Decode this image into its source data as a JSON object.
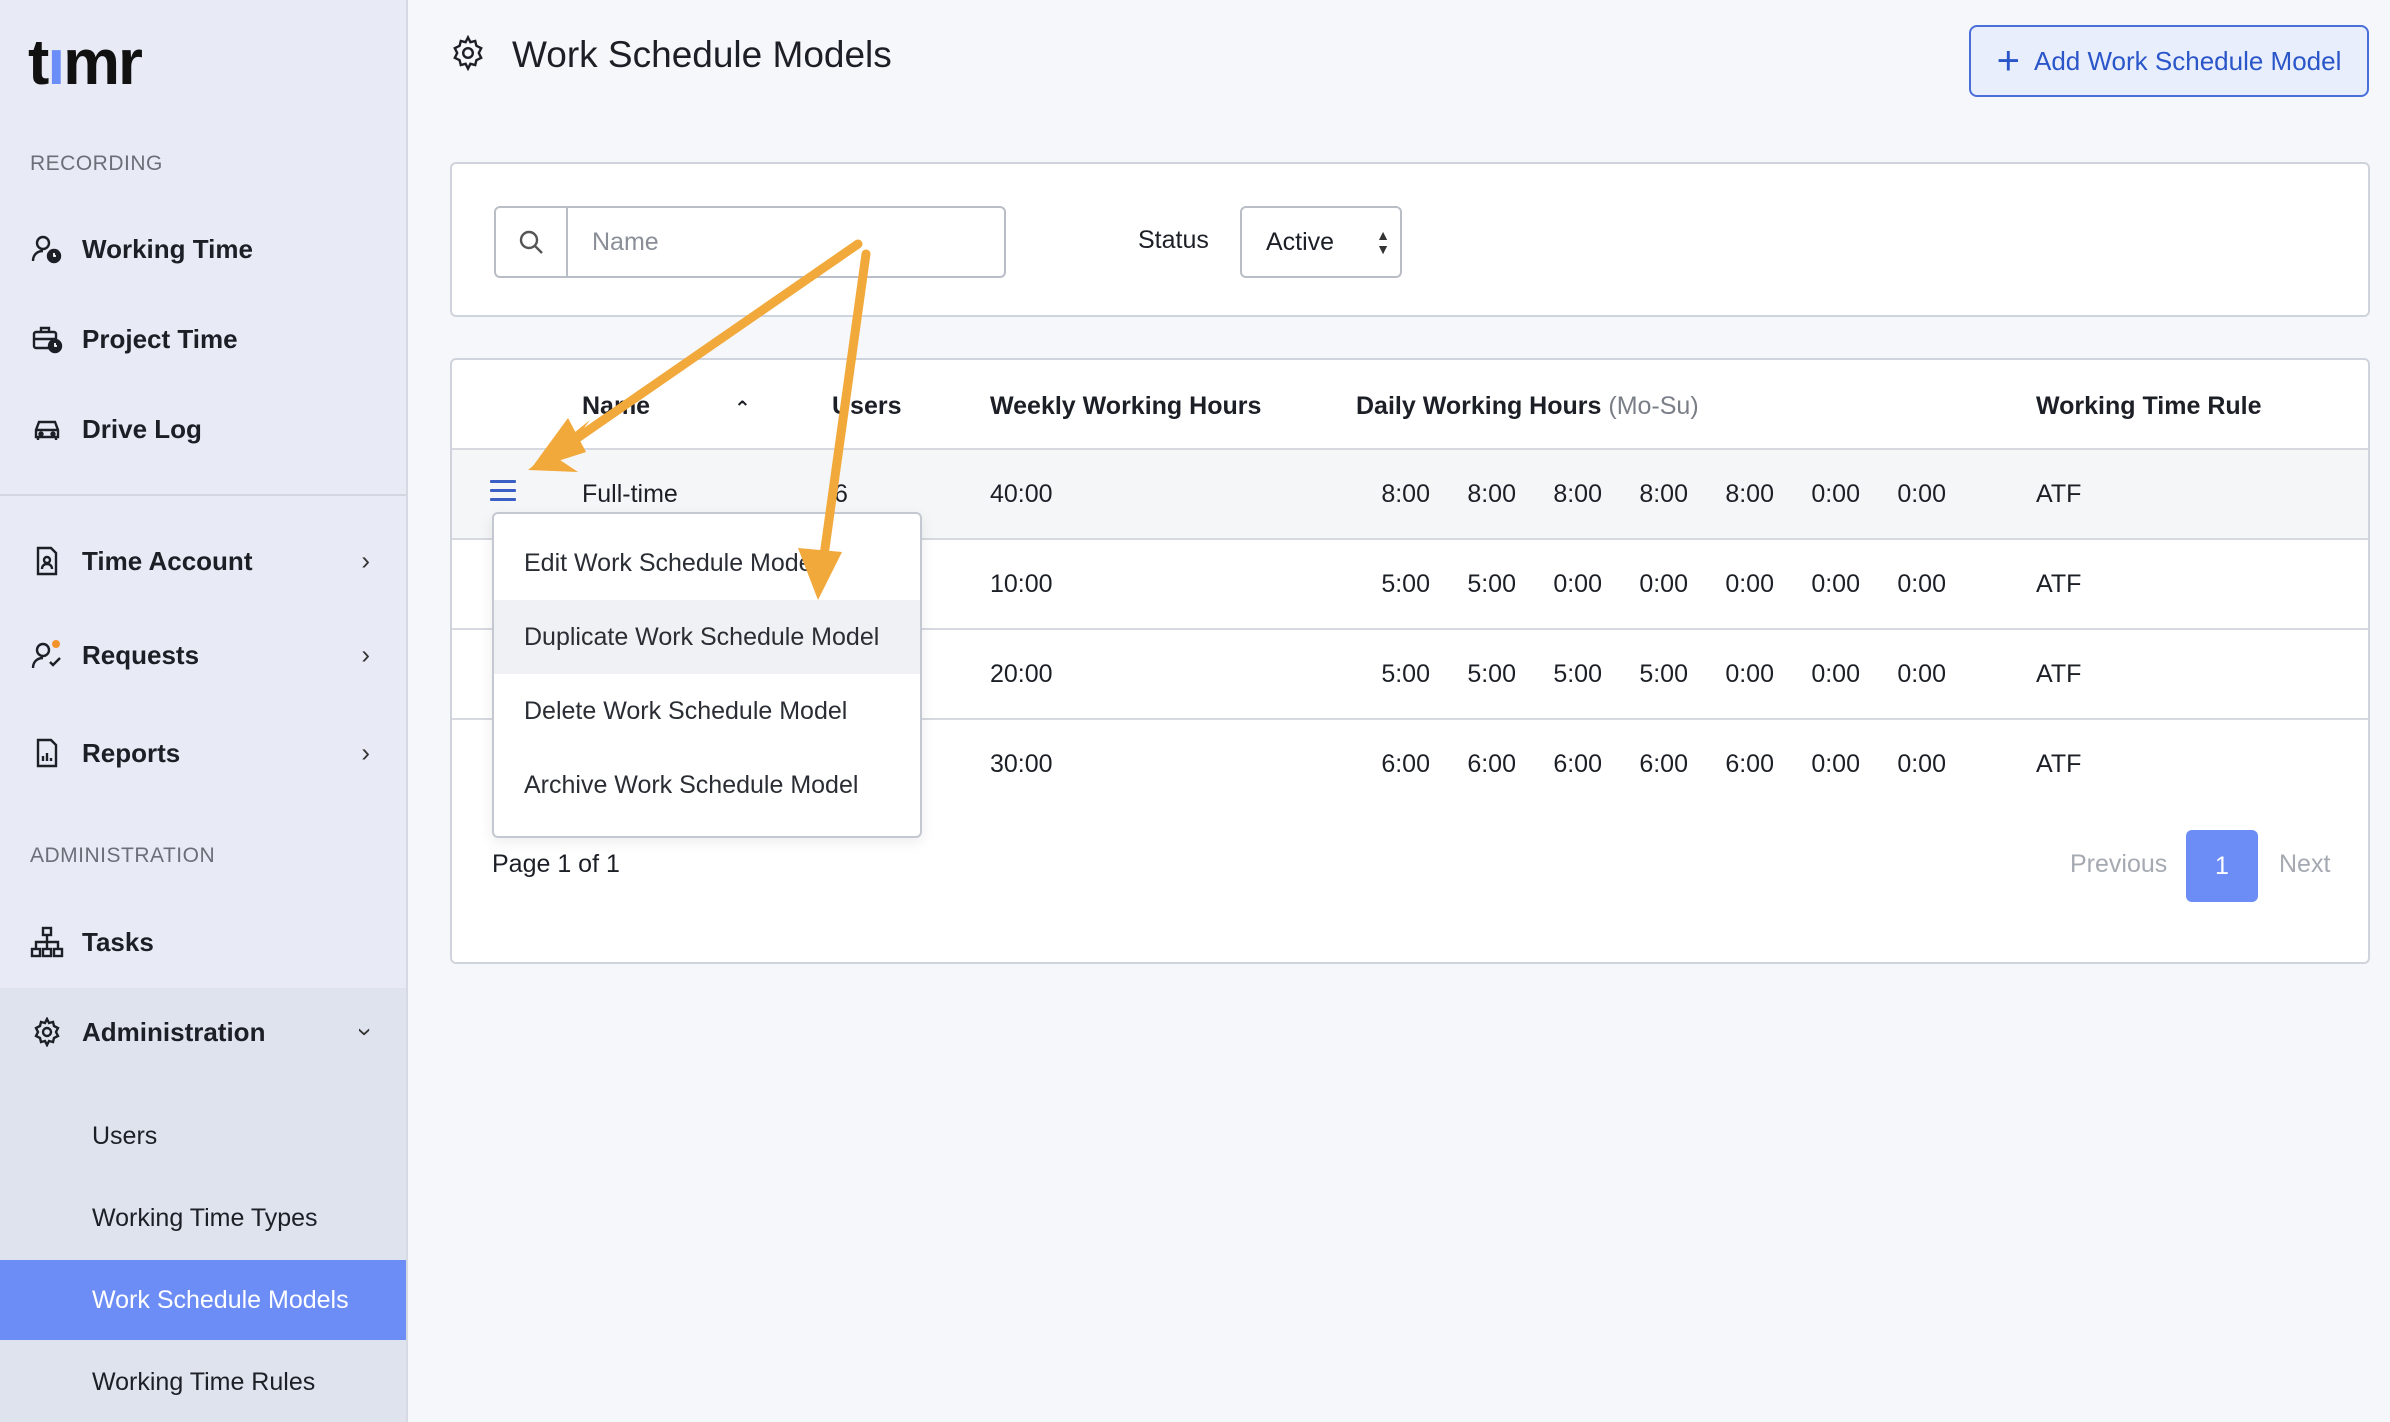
{
  "app": {
    "logo": "timr"
  },
  "sidebar": {
    "section_recording": "RECORDING",
    "section_administration": "ADMINISTRATION",
    "items": [
      {
        "label": "Working Time",
        "icon": "user-clock-icon"
      },
      {
        "label": "Project Time",
        "icon": "briefcase-clock-icon"
      },
      {
        "label": "Drive Log",
        "icon": "car-icon"
      },
      {
        "label": "Time Account",
        "icon": "file-user-icon"
      },
      {
        "label": "Requests",
        "icon": "user-check-icon"
      },
      {
        "label": "Reports",
        "icon": "report-icon"
      },
      {
        "label": "Tasks",
        "icon": "hierarchy-icon"
      },
      {
        "label": "Administration",
        "icon": "gear-icon"
      }
    ],
    "sub_items": [
      "Users",
      "Working Time Types",
      "Work Schedule Models",
      "Working Time Rules"
    ],
    "active_sub": "Work Schedule Models"
  },
  "header": {
    "title": "Work Schedule Models",
    "add_button": "Add Work Schedule Model"
  },
  "filter": {
    "search_placeholder": "Name",
    "status_label": "Status",
    "status_value": "Active"
  },
  "table": {
    "columns": {
      "name": "Name",
      "users": "Users",
      "weekly": "Weekly Working Hours",
      "daily": "Daily Working Hours",
      "daily_suffix": "(Mo-Su)",
      "rule": "Working Time Rule"
    },
    "rows": [
      {
        "name": "Full-time",
        "users": "6",
        "weekly": "40:00",
        "daily": [
          "8:00",
          "8:00",
          "8:00",
          "8:00",
          "8:00",
          "0:00",
          "0:00"
        ],
        "rule": "ATF"
      },
      {
        "name": "",
        "users": "",
        "weekly": "10:00",
        "daily": [
          "5:00",
          "5:00",
          "0:00",
          "0:00",
          "0:00",
          "0:00",
          "0:00"
        ],
        "rule": "ATF"
      },
      {
        "name": "",
        "users": "",
        "weekly": "20:00",
        "daily": [
          "5:00",
          "5:00",
          "5:00",
          "5:00",
          "0:00",
          "0:00",
          "0:00"
        ],
        "rule": "ATF"
      },
      {
        "name": "",
        "users": "",
        "weekly": "30:00",
        "daily": [
          "6:00",
          "6:00",
          "6:00",
          "6:00",
          "6:00",
          "0:00",
          "0:00"
        ],
        "rule": "ATF"
      }
    ]
  },
  "pagination": {
    "text": "Page 1 of 1",
    "previous": "Previous",
    "page": "1",
    "next": "Next"
  },
  "context_menu": {
    "items": [
      "Edit Work Schedule Model",
      "Duplicate Work Schedule Model",
      "Delete Work Schedule Model",
      "Archive Work Schedule Model"
    ],
    "hovered": "Duplicate Work Schedule Model"
  },
  "colors": {
    "accent": "#6c8df5",
    "arrow": "#f2a93b",
    "link": "#2a56c9"
  }
}
